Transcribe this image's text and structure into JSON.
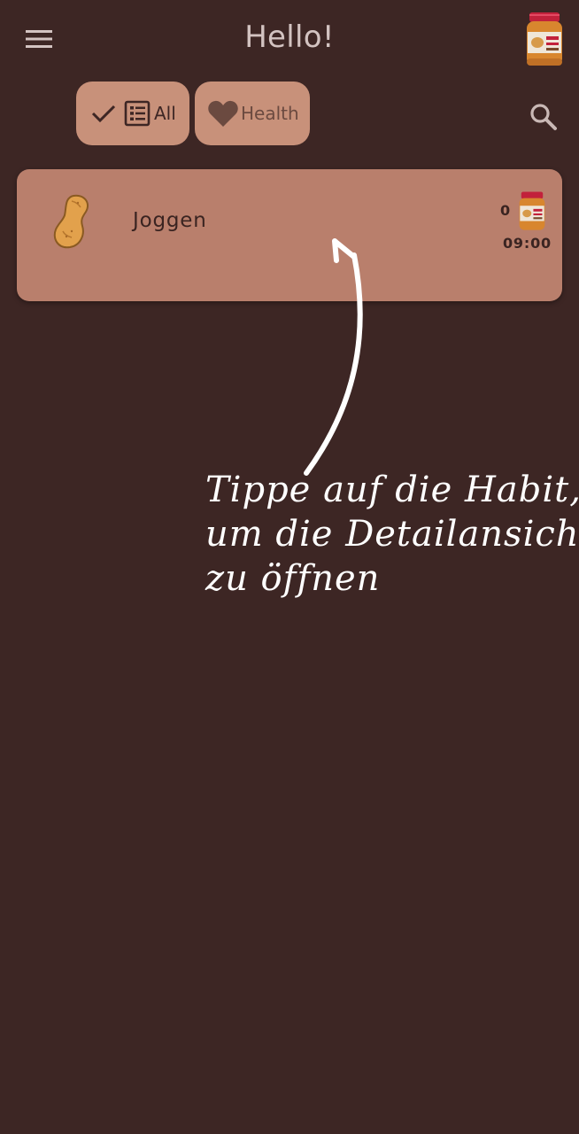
{
  "appbar": {
    "title": "Hello!",
    "menu_icon": "hamburger-menu-icon",
    "avatar_icon": "peanut-butter-jar-icon"
  },
  "filters": {
    "chips": [
      {
        "label": "All",
        "icons": [
          "check-icon",
          "list-icon"
        ],
        "selected": true
      },
      {
        "label": "Health",
        "icons": [
          "heart-icon"
        ],
        "selected": false
      }
    ],
    "search_icon": "search-icon"
  },
  "habits": [
    {
      "name": "Joggen",
      "icon": "peanut-icon",
      "count": "0",
      "jar_icon": "peanut-butter-jar-icon",
      "time": "09:00"
    }
  ],
  "hint": {
    "lines": [
      "Tippe auf die Habit,",
      "um die Detailansicht",
      "zu öffnen"
    ]
  },
  "colors": {
    "background": "#3d2624",
    "chip": "#c8917a",
    "card": "#b97f6c",
    "title": "#d3c3c1"
  }
}
